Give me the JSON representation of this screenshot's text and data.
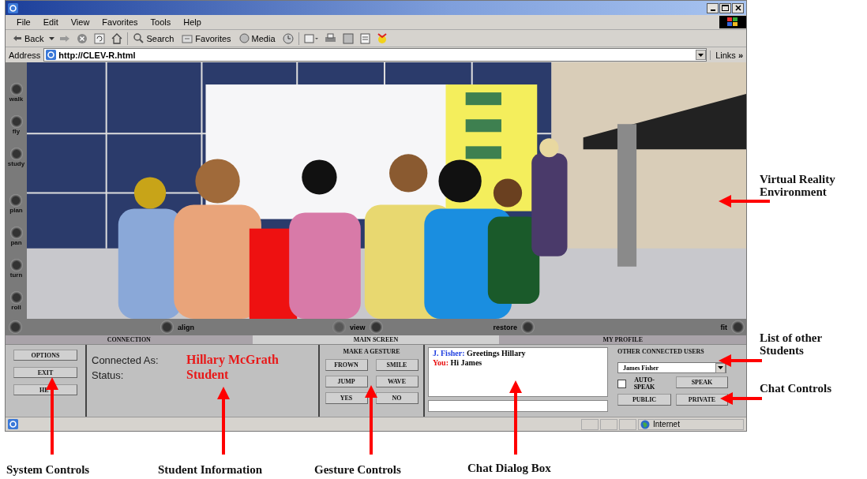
{
  "menu": [
    "File",
    "Edit",
    "View",
    "Favorites",
    "Tools",
    "Help"
  ],
  "toolbar": [
    "Back",
    "Search",
    "Favorites",
    "Media"
  ],
  "address": {
    "label": "Address",
    "value": "http://CLEV-R.html",
    "links": "Links",
    "more": "»"
  },
  "nav_left": [
    "walk",
    "fly",
    "study",
    "plan",
    "pan",
    "turn",
    "roll"
  ],
  "nav_bottom": [
    "align",
    "view",
    "restore",
    "fit"
  ],
  "tabs": [
    {
      "label": "CONNECTION",
      "selected": false
    },
    {
      "label": "MAIN SCREEN",
      "selected": true
    },
    {
      "label": "MY PROFILE",
      "selected": false
    }
  ],
  "system_buttons": [
    "OPTIONS",
    "EXIT",
    "HE"
  ],
  "student": {
    "connected_label": "Connected As:",
    "name": "Hillary McGrath",
    "status_label": "Status:",
    "status": "Student"
  },
  "gestures": {
    "title": "MAKE A GESTURE",
    "buttons": [
      "FROWN",
      "SMILE",
      "JUMP",
      "WAVE",
      "YES",
      "NO"
    ]
  },
  "chat": {
    "messages": [
      {
        "sender": "J. Fisher:",
        "text": "Greetings Hillary",
        "color": "#1f3fe0"
      },
      {
        "sender": "You:",
        "text": "Hi James",
        "color": "#e81010"
      }
    ]
  },
  "users": {
    "title": "OTHER CONNECTED USERS",
    "selected_user": "James Fisher",
    "auto_speak": {
      "label": "AUTO-SPEAK",
      "checked": false
    },
    "buttons": [
      "SPEAK",
      "PUBLIC",
      "PRIVATE"
    ]
  },
  "status_bar": {
    "zone": "Internet"
  },
  "annotations": [
    "Virtual Reality Environment",
    "List of other Students",
    "Chat Controls",
    "System Controls",
    "Student Information",
    "Gesture Controls",
    "Chat Dialog Box"
  ]
}
